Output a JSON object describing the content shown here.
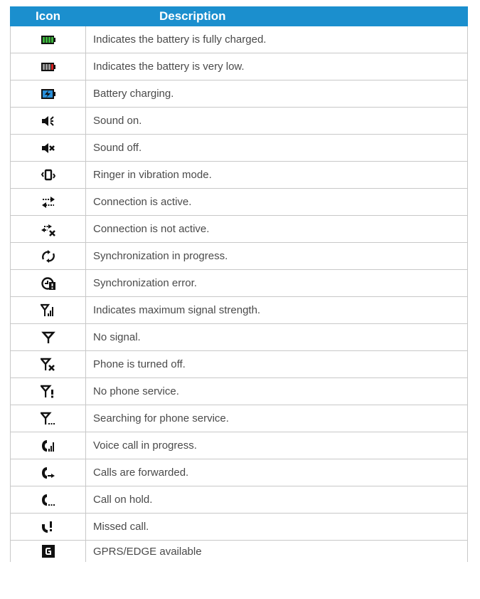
{
  "header": {
    "icon": "Icon",
    "description": "Description"
  },
  "rows": [
    {
      "icon": "battery-full-icon",
      "description": "Indicates the battery is fully charged."
    },
    {
      "icon": "battery-low-icon",
      "description": "Indicates the battery is very low."
    },
    {
      "icon": "battery-charging-icon",
      "description": "Battery charging."
    },
    {
      "icon": "sound-on-icon",
      "description": "Sound on."
    },
    {
      "icon": "sound-off-icon",
      "description": "Sound off."
    },
    {
      "icon": "vibration-icon",
      "description": "Ringer in vibration mode."
    },
    {
      "icon": "connection-active-icon",
      "description": "Connection is active."
    },
    {
      "icon": "connection-inactive-icon",
      "description": "Connection is not active."
    },
    {
      "icon": "sync-progress-icon",
      "description": "Synchronization in progress."
    },
    {
      "icon": "sync-error-icon",
      "description": "Synchronization error."
    },
    {
      "icon": "signal-max-icon",
      "description": "Indicates maximum signal strength."
    },
    {
      "icon": "no-signal-icon",
      "description": "No signal."
    },
    {
      "icon": "phone-off-icon",
      "description": "Phone is turned off."
    },
    {
      "icon": "no-service-icon",
      "description": "No phone service."
    },
    {
      "icon": "searching-service-icon",
      "description": "Searching for phone service."
    },
    {
      "icon": "voice-call-icon",
      "description": "Voice call in progress."
    },
    {
      "icon": "calls-forwarded-icon",
      "description": "Calls are forwarded."
    },
    {
      "icon": "call-hold-icon",
      "description": "Call on hold."
    },
    {
      "icon": "missed-call-icon",
      "description": "Missed call."
    },
    {
      "icon": "gprs-edge-icon",
      "description": "GPRS/EDGE available"
    }
  ],
  "colors": {
    "header_bg": "#1b8fce",
    "header_text": "#ffffff",
    "body_text": "#4a4a4a",
    "border": "#c8c8c8"
  }
}
